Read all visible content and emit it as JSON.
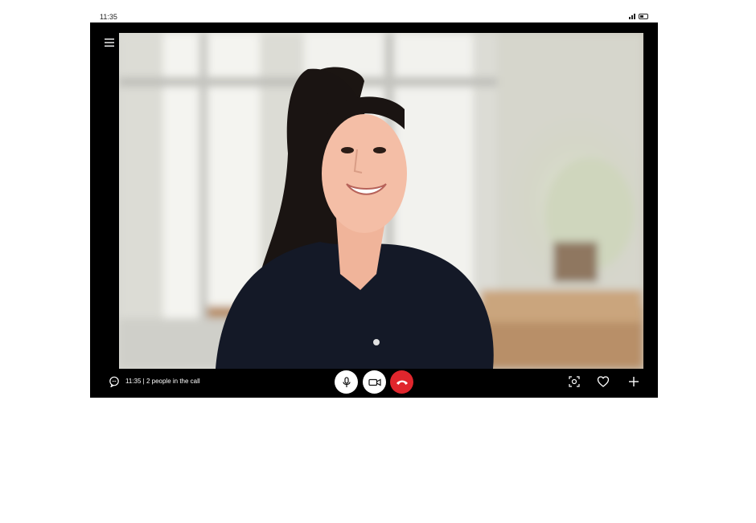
{
  "status_bar": {
    "time": "11:35",
    "icons": [
      "signal-icon",
      "battery-icon"
    ]
  },
  "call": {
    "info_text": "11:35 | 2 people in the call",
    "participant_video": "woman-participant-video"
  },
  "controls": {
    "left": [
      "menu-icon",
      "chat-icon"
    ],
    "center": [
      "microphone-icon",
      "video-camera-icon",
      "end-call-icon"
    ],
    "right": [
      "screenshot-icon",
      "heart-icon",
      "plus-icon"
    ]
  },
  "colors": {
    "frame": "#000000",
    "end_call": "#e0262d",
    "control_bg": "#ffffff"
  }
}
